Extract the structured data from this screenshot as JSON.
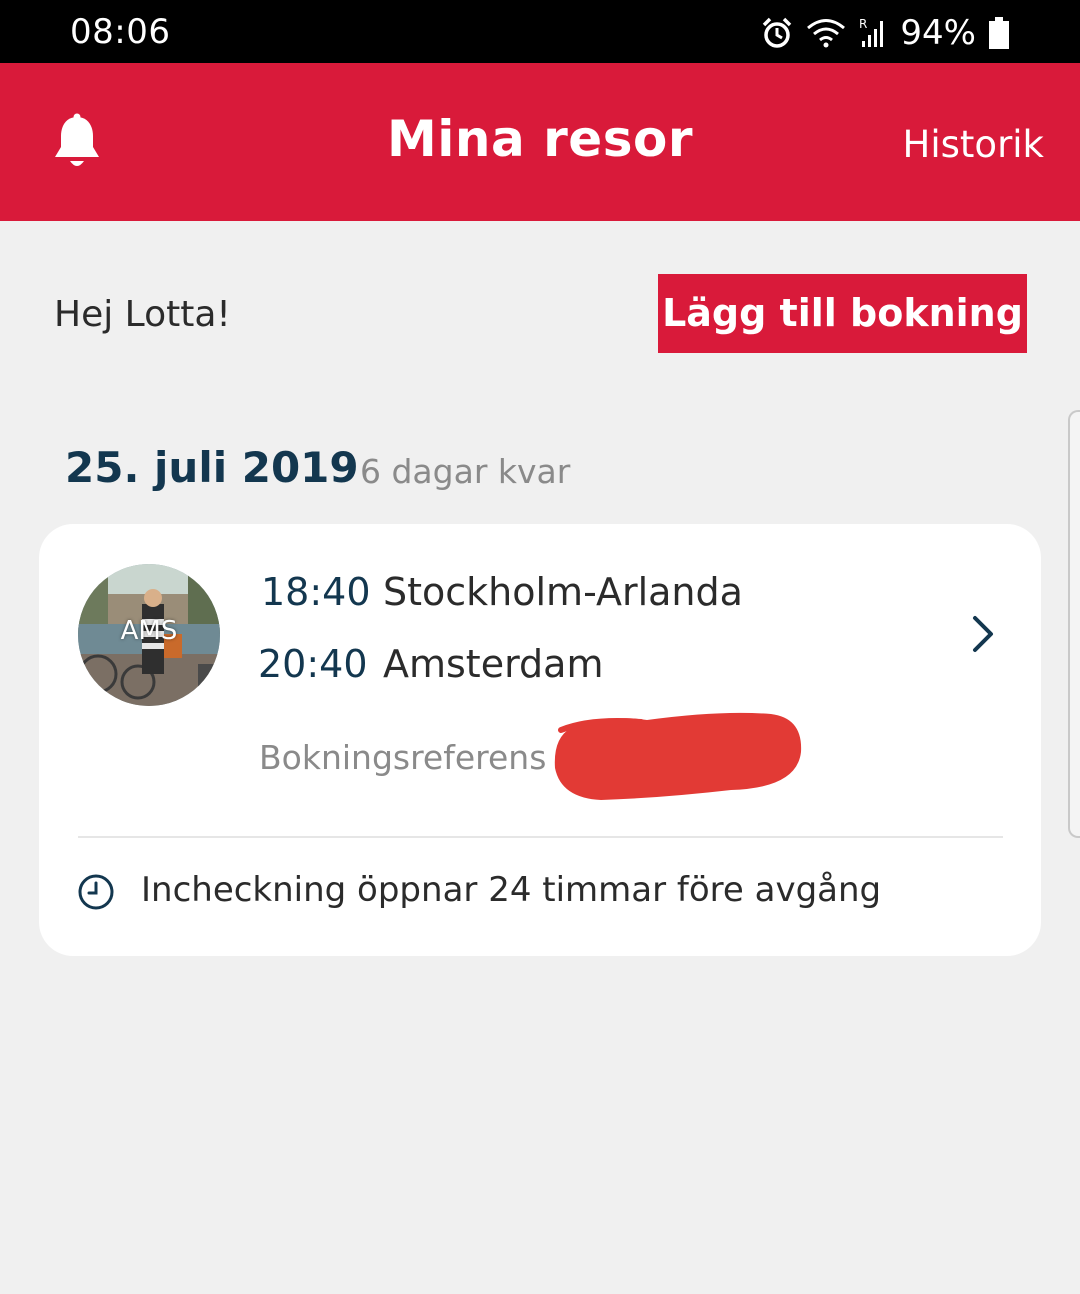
{
  "status_bar": {
    "time": "08:06",
    "battery_percent": "94%",
    "icons": [
      "alarm-icon",
      "wifi-icon",
      "roaming-icon",
      "signal-icon",
      "battery-icon"
    ]
  },
  "header": {
    "title": "Mina resor",
    "history_label": "Historik",
    "bell_icon": "bell-icon"
  },
  "greeting": "Hej Lotta!",
  "add_booking_label": "Lägg till bokning",
  "trip": {
    "date": "25. juli 2019",
    "days_left": "6 dagar kvar",
    "destination_code": "AMS",
    "departure": {
      "time": "18:40",
      "place": "Stockholm-Arlanda"
    },
    "arrival": {
      "time": "20:40",
      "place": "Amsterdam"
    },
    "booking_reference_label": "Bokningsreferens",
    "checkin_info": "Incheckning öppnar 24 timmar före avgång"
  },
  "colors": {
    "brand_red": "#d91a3a",
    "navy": "#13374f",
    "background": "#f0f0f0",
    "redaction": "#e23a35"
  }
}
